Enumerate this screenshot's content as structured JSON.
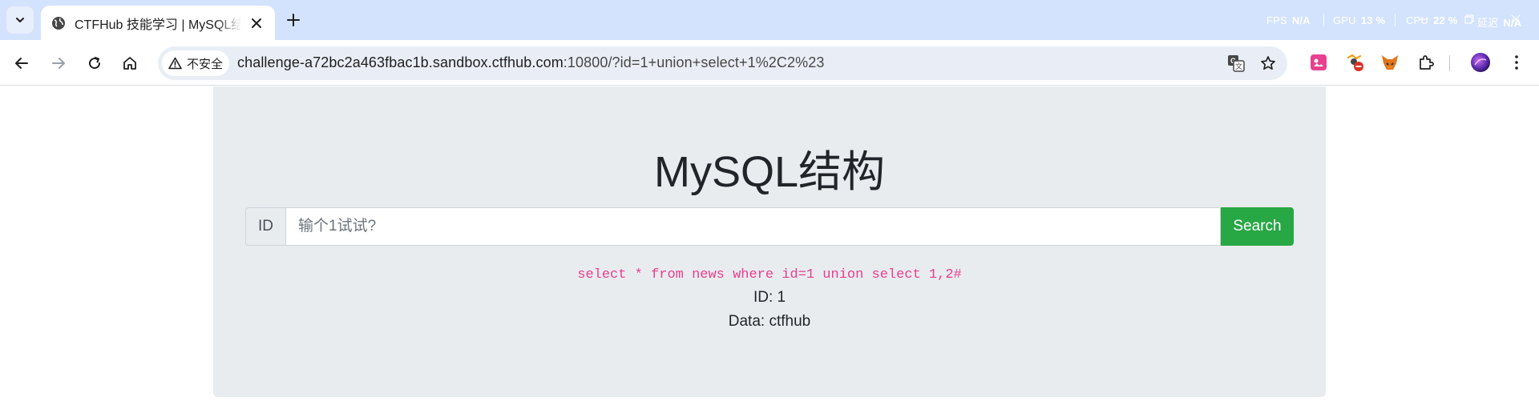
{
  "browser": {
    "tab": {
      "title": "CTFHub 技能学习 | MySQL结构"
    },
    "perf": {
      "fps_label": "FPS",
      "fps_value": "N/A",
      "gpu_label": "GPU",
      "gpu_value": "13 %",
      "cpu_label": "CPU",
      "cpu_value": "22 %",
      "extra_label": "延迟",
      "extra_value": "N/A"
    },
    "omnibox": {
      "security_label": "不安全",
      "url_host": "challenge-a72bc2a463fbac1b.sandbox.ctfhub.com",
      "url_rest": ":10800/?id=1+union+select+1%2C2%23"
    },
    "icons": {
      "tab_list": "chevron-down-icon",
      "favicon": "globe-icon",
      "tab_close": "close-icon",
      "new_tab": "plus-icon",
      "back": "back-arrow-icon",
      "forward": "forward-arrow-icon",
      "reload": "reload-icon",
      "home": "home-icon",
      "warning": "warning-icon",
      "translate": "translate-icon",
      "bookmark": "star-icon",
      "extensions": "puzzle-icon",
      "menu": "kebab-menu-icon"
    },
    "colors": {
      "tabstrip": "#d3e3fd",
      "omnibox": "#e9eef6"
    }
  },
  "page": {
    "heading": "MySQL结构",
    "search": {
      "label": "ID",
      "placeholder": "输个1试试?",
      "value": "",
      "button": "Search"
    },
    "query": "select * from news where id=1 union select 1,2#",
    "results": [
      "ID: 1",
      "Data: ctfhub"
    ],
    "colors": {
      "jumbotron": "#e9ecef",
      "button": "#28a745",
      "query": "#e83e8c"
    }
  }
}
